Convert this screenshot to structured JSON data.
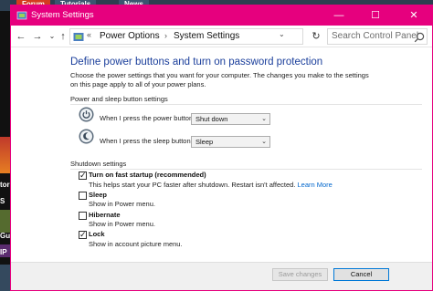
{
  "background": {
    "tabs": [
      "Forum",
      "Tutorials",
      "News"
    ],
    "left_text": [
      "tor",
      "S",
      "Gu",
      "IP"
    ]
  },
  "window": {
    "title": "System Settings",
    "controls": {
      "minimize": "—",
      "maximize": "☐",
      "close": "✕"
    }
  },
  "navbar": {
    "back": "←",
    "forward": "→",
    "recent": "⌄",
    "up": "↑",
    "separator": "«",
    "breadcrumbs": [
      "Power Options",
      "System Settings"
    ],
    "crumb_arrow": "›",
    "dropdown": "⌄",
    "refresh": "↻",
    "search_placeholder": "Search Control Panel"
  },
  "content": {
    "heading": "Define power buttons and turn on password protection",
    "description": "Choose the power settings that you want for your computer. The changes you make to the settings on this page apply to all of your power plans.",
    "power_section_label": "Power and sleep button settings",
    "power_rows": [
      {
        "label": "When I press the power button:",
        "value": "Shut down",
        "icon": "power-icon"
      },
      {
        "label": "When I press the sleep button:",
        "value": "Sleep",
        "icon": "moon-icon"
      }
    ],
    "shutdown_section_label": "Shutdown settings",
    "shutdown_options": [
      {
        "label": "Turn on fast startup (recommended)",
        "checked": true,
        "desc": "This helps start your PC faster after shutdown. Restart isn't affected.",
        "link": "Learn More"
      },
      {
        "label": "Sleep",
        "checked": false,
        "desc": "Show in Power menu."
      },
      {
        "label": "Hibernate",
        "checked": false,
        "desc": "Show in Power menu."
      },
      {
        "label": "Lock",
        "checked": true,
        "desc": "Show in account picture menu."
      }
    ]
  },
  "footer": {
    "save_label": "Save changes",
    "cancel_label": "Cancel"
  },
  "colors": {
    "title_bar": "#e6007e",
    "heading": "#1a3e9b",
    "link": "#0066cc"
  }
}
